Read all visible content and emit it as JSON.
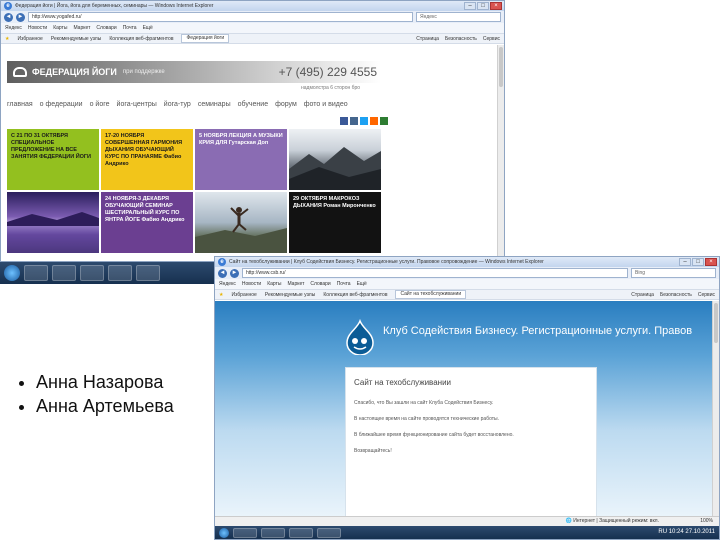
{
  "window1": {
    "title": "Федерация йоги | Йога, йога для беременных, семинары — Windows Internet Explorer",
    "url": "http://www.yogafed.ru/",
    "search_placeholder": "Яндекс",
    "links": [
      "Яндекс",
      "Новости",
      "Карты",
      "Маркет",
      "Словари",
      "Почта",
      "Ещё"
    ],
    "favorites_label": "Избранное",
    "fav_items": [
      "Рекомендуемые узлы",
      "Коллекция веб-фрагментов"
    ],
    "tab_title": "Федерация йоги",
    "tools": [
      "Страница",
      "Безопасность",
      "Сервис"
    ],
    "site": {
      "logo": "ФЕДЕРАЦИЯ ЙОГИ",
      "logo_sub": "при поддержке",
      "phone": "+7 (495) 229 4555",
      "subphone": "надмолстра 6 сторон бро",
      "nav": [
        "главная",
        "о федерации",
        "о йоге",
        "йога-центры",
        "йога-тур",
        "семинары",
        "обучение",
        "форум",
        "фото и видео"
      ],
      "banners": [
        {
          "text": "С 21 ПО 31 ОКТЯБРЯ СПЕЦИАЛЬНОЕ ПРЕДЛОЖЕНИЕ НА ВСЕ ЗАНЯТИЯ ФЕДЕРАЦИИ ЙОГИ",
          "bg": "#93c01f",
          "fg": "#1a1a1a"
        },
        {
          "text": "17-20 НОЯБРЯ СОВЕРШЕННАЯ ГАРМОНИЯ ДЫХАНИЯ ОБУЧАЮЩИЙ КУРС ПО ПРАНАЯМЕ Фабио Андрико",
          "bg": "#f2c51a",
          "fg": "#1a1a1a"
        },
        {
          "text": "5 НОЯБРЯ ЛЕКЦИЯ А МУЗЫКИ КРИЯ ДЛЯ Гутарская Доп",
          "bg": "#8a6cb3",
          "fg": "#ffffff"
        },
        {
          "text": "",
          "bg": "#cfd3d8",
          "fg": "#ffffff",
          "photo": "mountains"
        },
        {
          "text": "",
          "bg": "#4b2f7a",
          "fg": "#ffffff",
          "photo": "lake"
        },
        {
          "text": "24 НОЯБРЯ-3 ДЕКАБРЯ ОБУЧАЮЩИЙ СЕМИНАР ШЕСТИРАЛЬНЫЙ КУРС ПО ЯНТРА ЙОГЕ Фабио Андрико",
          "bg": "#6b3f91",
          "fg": "#ffffff"
        },
        {
          "text": "",
          "bg": "#8fa4b8",
          "fg": "#ffffff",
          "photo": "jumper"
        },
        {
          "text": "29 ОКТЯБРЯ МАКРОКОЗ ДЫХАНИЯ Роман Миронченко",
          "bg": "#121212",
          "fg": "#ffffff"
        }
      ]
    }
  },
  "window2": {
    "title": "Сайт на техобслуживании | Клуб Содействия Бизнесу. Регистрационные услуги. Правовое сопровождение — Windows Internet Explorer",
    "url": "http://www.csb.ru/",
    "search_placeholder": "Bing",
    "links": [
      "Яндекс",
      "Новости",
      "Карты",
      "Маркет",
      "Словари",
      "Почта",
      "Ещё"
    ],
    "favorites_label": "Избранное",
    "fav_items": [
      "Рекомендуемые узлы",
      "Коллекция веб-фрагментов"
    ],
    "tab_title": "Сайт на техобслуживании",
    "tools": [
      "Страница",
      "Безопасность",
      "Сервис"
    ],
    "site": {
      "header": "Клуб Содействия Бизнесу. Регистрационные услуги. Правов",
      "panel_title": "Сайт на техобслуживании",
      "lines": [
        "Спасибо, что Вы зашли на сайт Клуба Содействия Бизнесу.",
        "В настоящее время на сайте проводятся технические работы.",
        "В ближайшее время функционирование сайта будет восстановлено.",
        "Возвращайтесь!"
      ]
    },
    "status": "Интернет | Защищенный режим: вкл.",
    "zoom": "100%"
  },
  "bullets": [
    "Анна Назарова",
    "Анна Артемьева"
  ],
  "taskbar": {
    "time": "10:24",
    "date": "27.10.2011",
    "lang": "RU"
  }
}
